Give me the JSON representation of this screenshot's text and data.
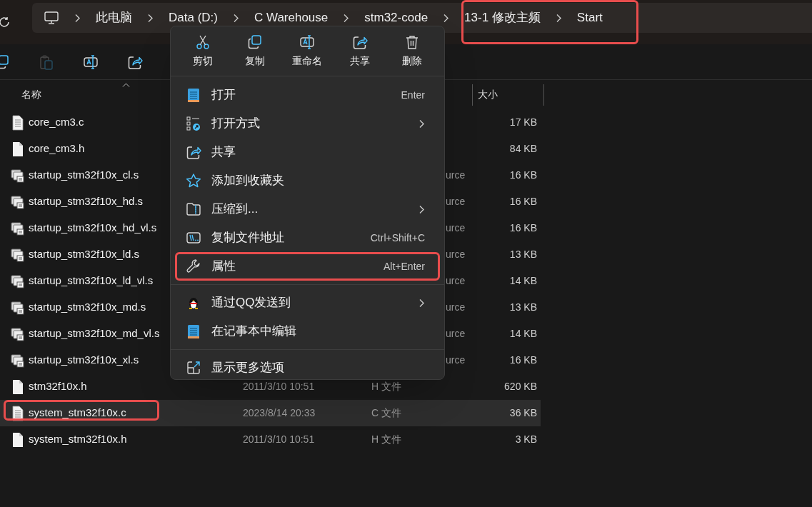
{
  "breadcrumb": {
    "items": [
      {
        "label": "此电脑",
        "highlighted": false
      },
      {
        "label": "Data (D:)",
        "highlighted": false
      },
      {
        "label": "C Warehouse",
        "highlighted": false
      },
      {
        "label": "stm32-code",
        "highlighted": false
      },
      {
        "label": "13-1 修改主频",
        "highlighted": true
      },
      {
        "label": "Start",
        "highlighted": true
      }
    ]
  },
  "toolbar": {
    "items": [
      {
        "kind": "copy",
        "disabled": false
      },
      {
        "kind": "paste",
        "disabled": true
      },
      {
        "kind": "rename",
        "disabled": false
      },
      {
        "kind": "share",
        "disabled": false
      }
    ]
  },
  "table": {
    "columns": [
      {
        "label": "名称"
      },
      {
        "label": "大小"
      }
    ],
    "rows": [
      {
        "kind": "c-file",
        "name": "core_cm3.c",
        "date": "",
        "type": "",
        "size": "17 KB",
        "selected": false,
        "highlighted": false
      },
      {
        "kind": "h-file",
        "name": "core_cm3.h",
        "date": "",
        "type": "",
        "size": "84 KB",
        "selected": false,
        "highlighted": false
      },
      {
        "kind": "asm-file",
        "name": "startup_stm32f10x_cl.s",
        "date": "",
        "type": "urce",
        "size": "16 KB",
        "selected": false,
        "highlighted": false
      },
      {
        "kind": "asm-file",
        "name": "startup_stm32f10x_hd.s",
        "date": "",
        "type": "urce",
        "size": "16 KB",
        "selected": false,
        "highlighted": false
      },
      {
        "kind": "asm-file",
        "name": "startup_stm32f10x_hd_vl.s",
        "date": "",
        "type": "urce",
        "size": "16 KB",
        "selected": false,
        "highlighted": false
      },
      {
        "kind": "asm-file",
        "name": "startup_stm32f10x_ld.s",
        "date": "",
        "type": "urce",
        "size": "13 KB",
        "selected": false,
        "highlighted": false
      },
      {
        "kind": "asm-file",
        "name": "startup_stm32f10x_ld_vl.s",
        "date": "",
        "type": "urce",
        "size": "14 KB",
        "selected": false,
        "highlighted": false
      },
      {
        "kind": "asm-file",
        "name": "startup_stm32f10x_md.s",
        "date": "",
        "type": "urce",
        "size": "13 KB",
        "selected": false,
        "highlighted": false
      },
      {
        "kind": "asm-file",
        "name": "startup_stm32f10x_md_vl.s",
        "date": "",
        "type": "urce",
        "size": "14 KB",
        "selected": false,
        "highlighted": false
      },
      {
        "kind": "asm-file",
        "name": "startup_stm32f10x_xl.s",
        "date": "",
        "type": "urce",
        "size": "16 KB",
        "selected": false,
        "highlighted": false
      },
      {
        "kind": "h-file",
        "name": "stm32f10x.h",
        "date": "2011/3/10 10:51",
        "type": "H 文件",
        "size": "620 KB",
        "selected": false,
        "highlighted": false
      },
      {
        "kind": "c-file",
        "name": "system_stm32f10x.c",
        "date": "2023/8/14 20:33",
        "type": "C 文件",
        "size": "36 KB",
        "selected": true,
        "highlighted": true
      },
      {
        "kind": "h-file",
        "name": "system_stm32f10x.h",
        "date": "2011/3/10 10:51",
        "type": "H 文件",
        "size": "3 KB",
        "selected": false,
        "highlighted": false
      }
    ]
  },
  "context_menu": {
    "actions": [
      {
        "kind": "cut",
        "label": "剪切"
      },
      {
        "kind": "copy",
        "label": "复制"
      },
      {
        "kind": "rename",
        "label": "重命名"
      },
      {
        "kind": "share",
        "label": "共享"
      },
      {
        "kind": "delete",
        "label": "删除"
      }
    ],
    "items": [
      {
        "kind": "item",
        "label": "打开",
        "shortcut": "Enter",
        "submenu": false,
        "highlighted": false
      },
      {
        "kind": "item",
        "label": "打开方式",
        "submenu": true,
        "highlighted": false
      },
      {
        "kind": "item",
        "label": "共享",
        "submenu": false,
        "highlighted": false
      },
      {
        "kind": "item",
        "label": "添加到收藏夹",
        "submenu": false,
        "highlighted": false
      },
      {
        "kind": "item",
        "label": "压缩到...",
        "submenu": true,
        "highlighted": false
      },
      {
        "kind": "item",
        "label": "复制文件地址",
        "shortcut": "Ctrl+Shift+C",
        "submenu": false,
        "highlighted": false
      },
      {
        "kind": "item",
        "label": "属性",
        "shortcut": "Alt+Enter",
        "submenu": false,
        "highlighted": true
      },
      {
        "kind": "separator"
      },
      {
        "kind": "item",
        "label": "通过QQ发送到",
        "submenu": true,
        "highlighted": false
      },
      {
        "kind": "item",
        "label": "在记事本中编辑",
        "submenu": false,
        "highlighted": false
      },
      {
        "kind": "separator"
      },
      {
        "kind": "item",
        "label": "显示更多选项",
        "submenu": false,
        "highlighted": false
      }
    ]
  }
}
